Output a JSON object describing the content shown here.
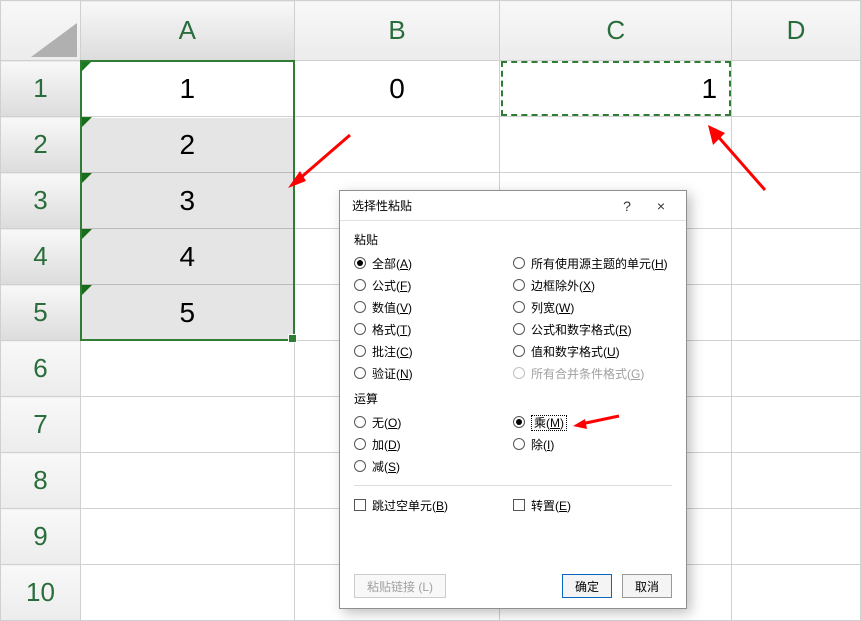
{
  "columns": [
    "A",
    "B",
    "C",
    "D"
  ],
  "rows": [
    "1",
    "2",
    "3",
    "4",
    "5",
    "6",
    "7",
    "8",
    "9",
    "10"
  ],
  "cells": {
    "A1": "1",
    "A2": "2",
    "A3": "3",
    "A4": "4",
    "A5": "5",
    "B1": "0",
    "C1": "1"
  },
  "dialog": {
    "title": "选择性粘贴",
    "help": "?",
    "close": "×",
    "paste_label": "粘贴",
    "paste_opts_left": [
      {
        "label": "全部",
        "key": "A",
        "sel": true
      },
      {
        "label": "公式",
        "key": "F"
      },
      {
        "label": "数值",
        "key": "V"
      },
      {
        "label": "格式",
        "key": "T"
      },
      {
        "label": "批注",
        "key": "C"
      },
      {
        "label": "验证",
        "key": "N"
      }
    ],
    "paste_opts_right": [
      {
        "label": "所有使用源主题的单元",
        "key": "H"
      },
      {
        "label": "边框除外",
        "key": "X"
      },
      {
        "label": "列宽",
        "key": "W"
      },
      {
        "label": "公式和数字格式",
        "key": "R"
      },
      {
        "label": "值和数字格式",
        "key": "U"
      },
      {
        "label": "所有合并条件格式",
        "key": "G",
        "disabled": true
      }
    ],
    "op_label": "运算",
    "op_opts_left": [
      {
        "label": "无",
        "key": "O"
      },
      {
        "label": "加",
        "key": "D"
      },
      {
        "label": "减",
        "key": "S"
      }
    ],
    "op_opts_right": [
      {
        "label": "乘",
        "key": "M",
        "sel": true,
        "focus": true
      },
      {
        "label": "除",
        "key": "I"
      }
    ],
    "skip_blanks": {
      "label": "跳过空单元",
      "key": "B"
    },
    "transpose": {
      "label": "转置",
      "key": "E"
    },
    "paste_link": "粘贴链接 (L)",
    "ok": "确定",
    "cancel": "取消"
  }
}
